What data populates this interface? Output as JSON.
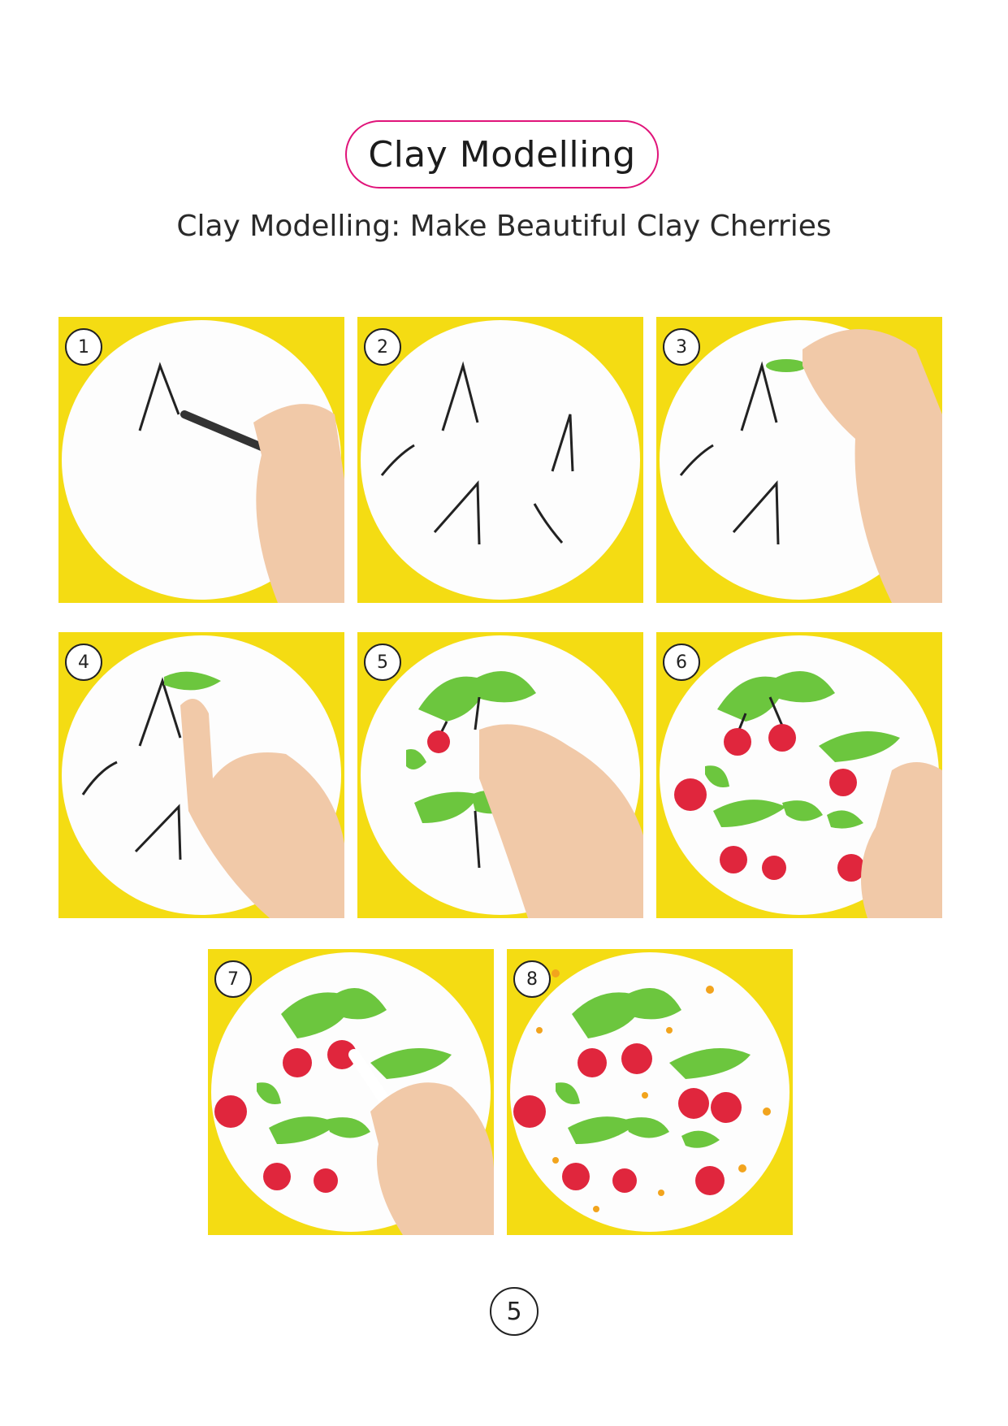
{
  "header": {
    "title": "Clay Modelling"
  },
  "subtitle": "Clay Modelling: Make Beautiful Clay Cherries",
  "steps": [
    {
      "number": "1",
      "description_shown": ""
    },
    {
      "number": "2"
    },
    {
      "number": "3"
    },
    {
      "number": "4"
    },
    {
      "number": "5"
    },
    {
      "number": "6"
    },
    {
      "number": "7"
    },
    {
      "number": "8"
    }
  ],
  "footer": {
    "page_number": "5"
  },
  "colors": {
    "accent": "#e0147a",
    "background_yellow": "#f4dc13",
    "leaf_green": "#6cc63e",
    "cherry_red": "#e0263d"
  }
}
